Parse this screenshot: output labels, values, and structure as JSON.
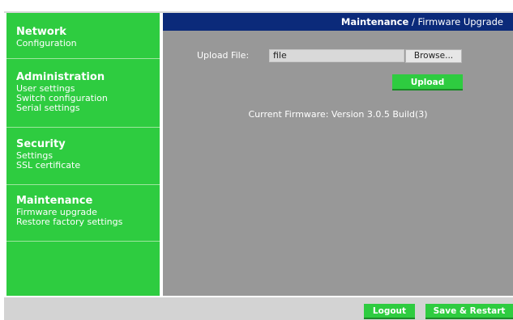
{
  "sidebar": {
    "network": {
      "title": "Network",
      "items": [
        "Configuration"
      ]
    },
    "administration": {
      "title": "Administration",
      "items": [
        "User settings",
        "Switch configuration",
        "Serial settings"
      ]
    },
    "security": {
      "title": "Security",
      "items": [
        "Settings",
        "SSL certificate"
      ]
    },
    "maintenance": {
      "title": "Maintenance",
      "items": [
        "Firmware upgrade",
        "Restore factory settings"
      ]
    }
  },
  "breadcrumb": {
    "section": "Maintenance",
    "separator": "/",
    "page": "Firmware Upgrade"
  },
  "upload": {
    "label": "Upload File:",
    "file_value": "file",
    "browse_label": "Browse...",
    "upload_label": "Upload"
  },
  "firmware": {
    "text": "Current Firmware: Version 3.0.5 Build(3)"
  },
  "footer": {
    "logout_label": "Logout",
    "save_restart_label": "Save & Restart"
  },
  "colors": {
    "accent": "#2ecc40",
    "header": "#0b2a7a",
    "panel": "#989898"
  }
}
